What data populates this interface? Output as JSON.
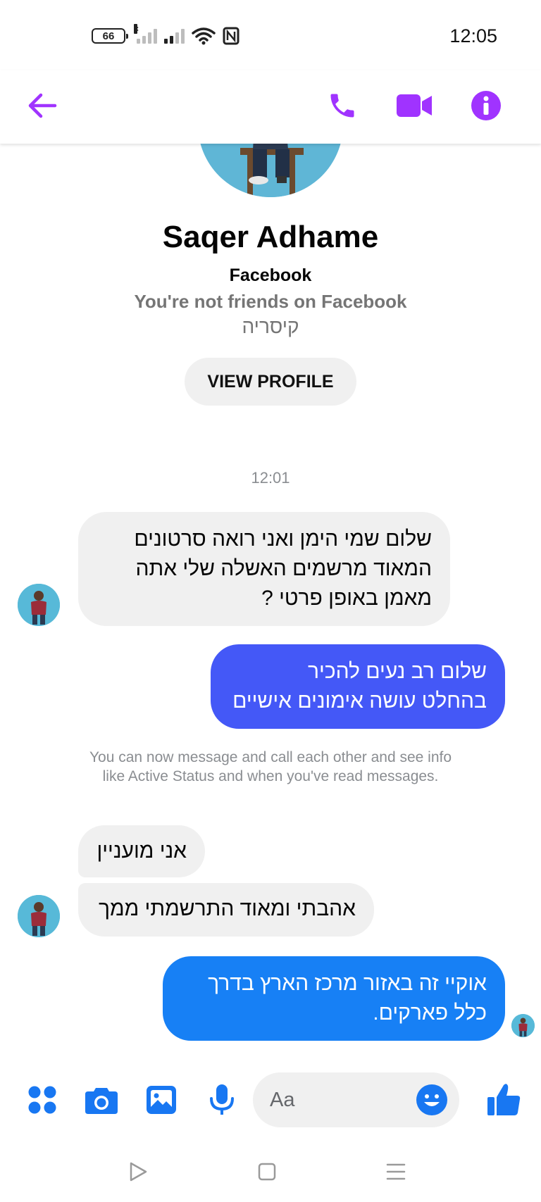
{
  "status_bar": {
    "battery": "66",
    "time": "12:05"
  },
  "header": {
    "icons": [
      "arrow-left-icon",
      "phone-icon",
      "video-camera-icon",
      "info-icon"
    ],
    "accent_color": "#a033ff"
  },
  "profile": {
    "name": "Saqer Adhame",
    "platform": "Facebook",
    "friend_status": "You're not friends on Facebook",
    "location": "קיסריה",
    "view_profile_label": "VIEW PROFILE"
  },
  "conversation": {
    "timestamp": "12:01",
    "messages": [
      {
        "direction": "incoming",
        "lines": [
          "שלום שמי הימן ואני רואה סרטונים",
          "המאוד מרשמים האשלה שלי אתה",
          "מאמן באופן פרטי ?"
        ]
      },
      {
        "direction": "outgoing",
        "lines": [
          "שלום רב נעים להכיר",
          "בהחלט עושה אימונים אישיים"
        ]
      },
      {
        "direction": "incoming",
        "lines": [
          "אני מועניין"
        ]
      },
      {
        "direction": "incoming",
        "lines": [
          "אהבתי ומאוד התרשמתי ממך"
        ]
      },
      {
        "direction": "outgoing",
        "lines": [
          "אוקיי זה באזור מרכז הארץ בדרך",
          "כלל פארקים."
        ]
      }
    ],
    "system_note": "You can now message and call each other and see info like Active Status and when you've read messages."
  },
  "composer": {
    "placeholder": "Aa",
    "icons": [
      "apps-icon",
      "camera-icon",
      "gallery-icon",
      "microphone-icon",
      "emoji-icon",
      "thumbs-up-icon"
    ],
    "accent_color": "#1877f2"
  },
  "colors": {
    "outgoing_first": "#4458f7",
    "outgoing_last": "#1780f5",
    "incoming": "#f0f0f0"
  },
  "navbar": {
    "icons": [
      "back-triangle-icon",
      "home-square-icon",
      "menu-lines-icon"
    ]
  }
}
